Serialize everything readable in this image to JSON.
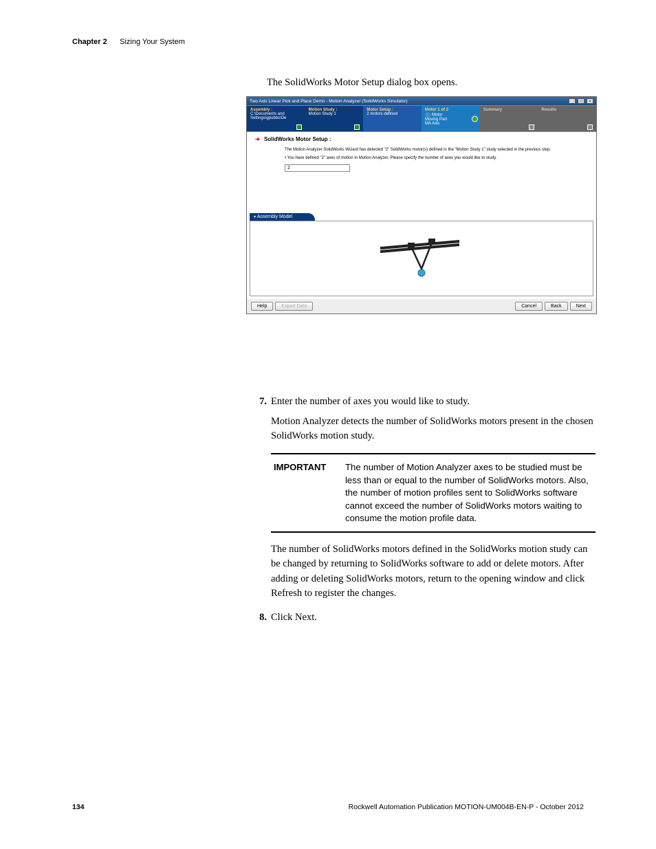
{
  "header": {
    "chapter": "Chapter 2",
    "section": "Sizing Your System"
  },
  "intro": "The SolidWorks Motor Setup dialog box opens.",
  "dialog": {
    "title": "Two Axis Linear Pick and Place Demo - Motion Analyzer  (SolidWorks Simulator)",
    "steps": {
      "assembly": {
        "label": "Assembly :",
        "sub": "C:\\Documents and Settings\\gpubbs\\De"
      },
      "motion": {
        "label": "Motion Study :",
        "sub": "Motion Study 1"
      },
      "motor": {
        "label": "Motor Setup :",
        "sub": "2 motors defined"
      },
      "current": {
        "label": "Motor 1 of 2",
        "sub": "Motor\nMoving Part\nMA Axis"
      },
      "summary": {
        "label": "Summary"
      },
      "results": {
        "label": "Results"
      }
    },
    "section_title": "SolidWorks Motor Setup :",
    "body": {
      "line1": "The Motion Analyzer SolidWorks Wizard has detected \"2\" SolidWorks motor(s) defined in the \"Motion Study 1\" study selected in the previous step.",
      "line2": "• You have defined \"2\" axes of motion in Motion Analyzer. Please specify the number of axes you would like to study.",
      "input_value": "2"
    },
    "assembly_model_label": "Assembly Model",
    "buttons": {
      "help": "Help",
      "export": "Export Data",
      "cancel": "Cancel",
      "back": "Back",
      "next": "Next"
    }
  },
  "steps_after": {
    "s7_num": "7.",
    "s7_text": "Enter the number of axes you would like to study.",
    "s7_para": "Motion Analyzer detects the number of SolidWorks motors present in the chosen SolidWorks motion study.",
    "important_label": "IMPORTANT",
    "important_text": "The number of Motion Analyzer axes to be studied must be less than or equal to the number of SolidWorks motors. Also, the number of motion profiles sent to SolidWorks software cannot exceed the number of SolidWorks motors waiting to consume the motion profile data.",
    "para2": "The number of SolidWorks motors defined in the SolidWorks motion study can be changed by returning to SolidWorks software to add or delete motors. After adding or deleting SolidWorks motors, return to the opening window and click Refresh to register the changes.",
    "s8_num": "8.",
    "s8_text": "Click Next."
  },
  "footer": {
    "page": "134",
    "pub": "Rockwell Automation Publication MOTION-UM004B-EN-P - October 2012"
  }
}
